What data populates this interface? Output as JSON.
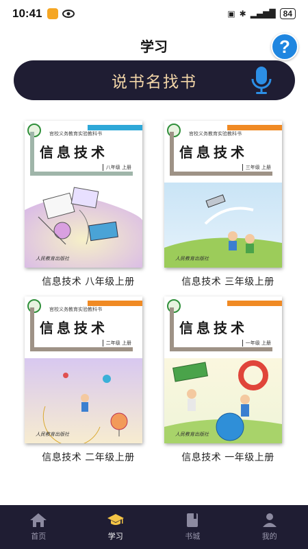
{
  "status": {
    "time": "10:41",
    "battery": "84"
  },
  "header": {
    "title": "学习",
    "help_label": "?"
  },
  "search": {
    "label": "说书名找书"
  },
  "books": [
    {
      "caption": "信息技术 八年级上册",
      "cover_title": "信息技术",
      "grade": "八年级 上册",
      "series": "官校义务教育实验教科书",
      "publisher": "人民教育出版社",
      "strip_color": "#2ea8d8"
    },
    {
      "caption": "信息技术 三年级上册",
      "cover_title": "信息技术",
      "grade": "三年级 上册",
      "series": "官校义务教育实验教科书",
      "publisher": "人民教育出版社",
      "strip_color": "#f08a24"
    },
    {
      "caption": "信息技术 二年级上册",
      "cover_title": "信息技术",
      "grade": "二年级 上册",
      "series": "官校义务教育实验教科书",
      "publisher": "人民教育出版社",
      "strip_color": "#f08a24"
    },
    {
      "caption": "信息技术 一年级上册",
      "cover_title": "信息技术",
      "grade": "一年级 上册",
      "series": "",
      "publisher": "人民教育出版社",
      "strip_color": "#f08a24"
    }
  ],
  "nav": [
    {
      "label": "首页",
      "icon": "home-icon"
    },
    {
      "label": "学习",
      "icon": "graduation-cap-icon",
      "active": true
    },
    {
      "label": "书城",
      "icon": "book-icon"
    },
    {
      "label": "我的",
      "icon": "person-icon"
    }
  ],
  "colors": {
    "accent": "#1f1d33",
    "help": "#1f86e0",
    "search_text": "#f3d6a8"
  }
}
